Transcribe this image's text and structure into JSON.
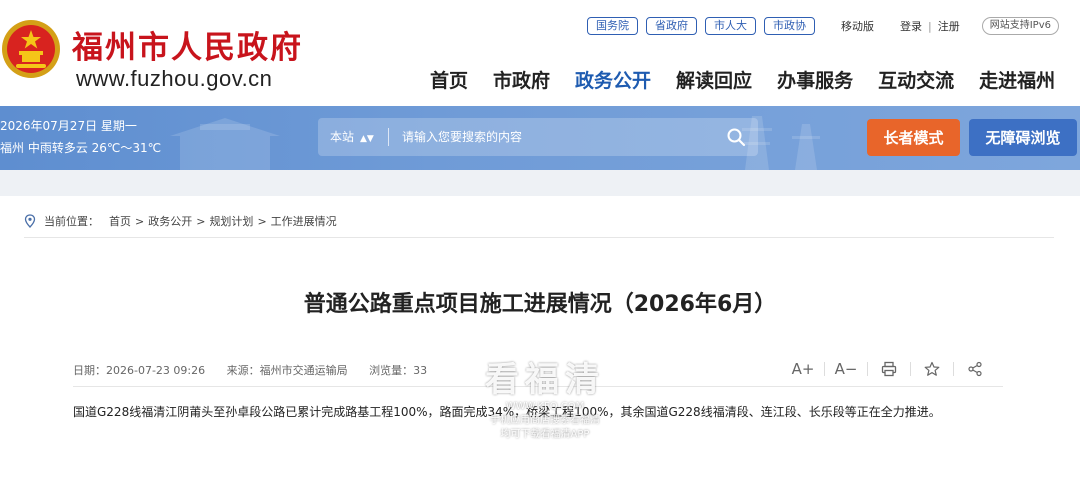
{
  "header": {
    "site_name": "福州市人民政府",
    "site_url": "www.fuzhou.gov.cn",
    "top_links": [
      "国务院",
      "省政府",
      "市人大",
      "市政协"
    ],
    "mobile": "移动版",
    "login": "登录",
    "register": "注册",
    "ipv6": "网站支持IPv6",
    "nav": [
      "首页",
      "市政府",
      "政务公开",
      "解读回应",
      "办事服务",
      "互动交流",
      "走进福州"
    ],
    "nav_active": "政务公开"
  },
  "banner": {
    "date": "2026年07月27日 星期一",
    "weather": "福州 中雨转多云 26℃～31℃",
    "search_scope": "本站",
    "search_placeholder": "请输入您要搜索的内容",
    "elder_mode": "长者模式",
    "accessible": "无障碍浏览"
  },
  "breadcrumb": {
    "label": "当前位置：",
    "items": [
      "首页",
      "政务公开",
      "规划计划",
      "工作进展情况"
    ],
    "separator": ">"
  },
  "article": {
    "title": "普通公路重点项目施工进展情况（2026年6月）",
    "date": "日期：2026-07-23 09:26",
    "source": "来源：福州市交通运输局",
    "views": "浏览量：33",
    "font_up": "A+",
    "font_down": "A−",
    "body": "国道G228线福清江阴莆头至孙卓段公路已累计完成路基工程100%，路面完成34%，桥梁工程100%，其余国道G228线福清段、连江段、长乐段等正在全力推进。"
  },
  "watermark": {
    "big": "看福清",
    "domain": "WWW.KFQ.COM",
    "line1": "手机应用商店搜索看福清",
    "line2": "均可下载看福清APP"
  },
  "colors": {
    "brand_red": "#c8141c",
    "nav_active": "#1e5bb0",
    "banner": "#6f9bd7",
    "elder_btn": "#e8652a",
    "access_btn": "#3d70c4"
  }
}
